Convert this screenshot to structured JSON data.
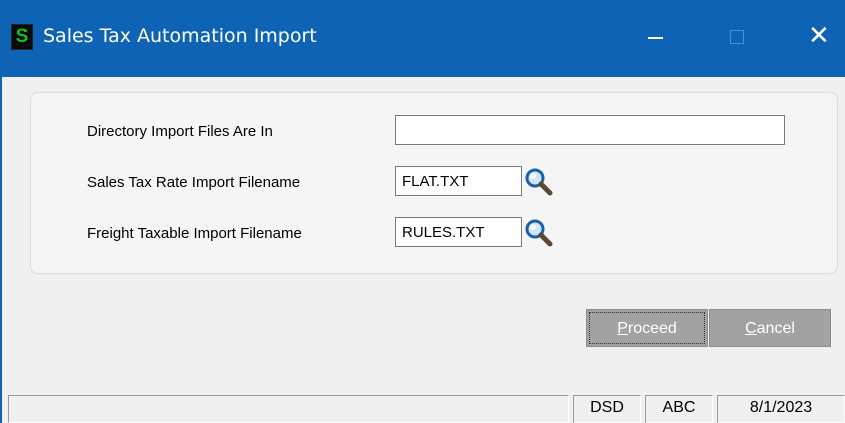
{
  "window": {
    "title": "Sales Tax Automation Import",
    "app_icon_letter": "S",
    "minimize_glyph": "minimize-icon",
    "maximize_glyph": "maximize-icon",
    "close_glyph": "✕"
  },
  "form": {
    "directory": {
      "label": "Directory Import Files Are In",
      "value": ""
    },
    "rate_file": {
      "label": "Sales Tax Rate Import Filename",
      "value": "FLAT.TXT"
    },
    "freight_file": {
      "label": "Freight Taxable Import Filename",
      "value": "RULES.TXT"
    }
  },
  "buttons": {
    "proceed": {
      "accel": "P",
      "rest": "roceed"
    },
    "cancel": {
      "accel": "C",
      "rest": "ancel"
    }
  },
  "status": {
    "cells": [
      "",
      "DSD",
      "ABC",
      "8/1/2023"
    ]
  },
  "colors": {
    "titlebar": "#0f63b5",
    "button": "#a2a2a2",
    "app_icon_fg": "#17c217"
  }
}
